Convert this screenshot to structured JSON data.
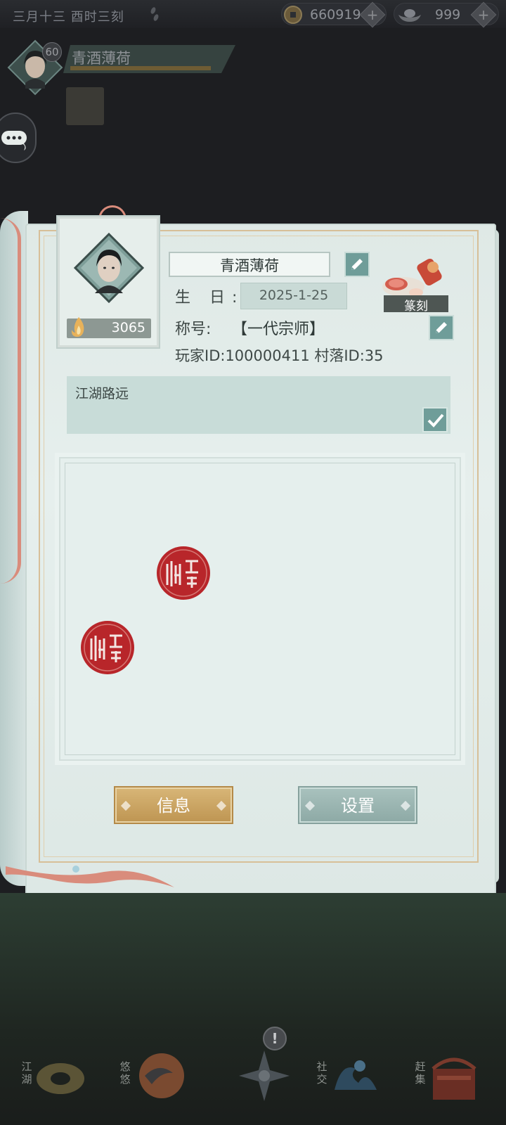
{
  "topbar": {
    "time": "三月十三  酉时三刻",
    "copper_value": "660919",
    "silver_value": "999",
    "plus": "+"
  },
  "player": {
    "level": "60",
    "name": "青酒薄荷"
  },
  "profile": {
    "name": "青酒薄荷",
    "birthday_label": "生 日:",
    "birthday": "2025-1-25",
    "title_label": "称号:",
    "title": "【一代宗师】",
    "ids": "玩家ID:100000411 村落ID:35",
    "power": "3065",
    "seal_label": "篆刻",
    "signature": "江湖路远"
  },
  "buttons": {
    "info": "信息",
    "settings": "设置"
  },
  "bottom_nav": [
    {
      "label": "江湖"
    },
    {
      "label": "悠悠"
    },
    {
      "label": ""
    },
    {
      "label": "社交"
    },
    {
      "label": "赶集"
    }
  ],
  "alert": "!",
  "colors": {
    "accent_teal": "#6f9d99",
    "gold_button": "#c9a05f",
    "stamp_red": "#b8262a",
    "page_bg": "#e2ecea"
  },
  "icons": [
    "sycee-icon",
    "copper-coin-icon",
    "plus-icon",
    "pencil-icon",
    "check-icon",
    "flame-icon",
    "chat-icon",
    "seal-stamp-icon",
    "compass-icon"
  ]
}
